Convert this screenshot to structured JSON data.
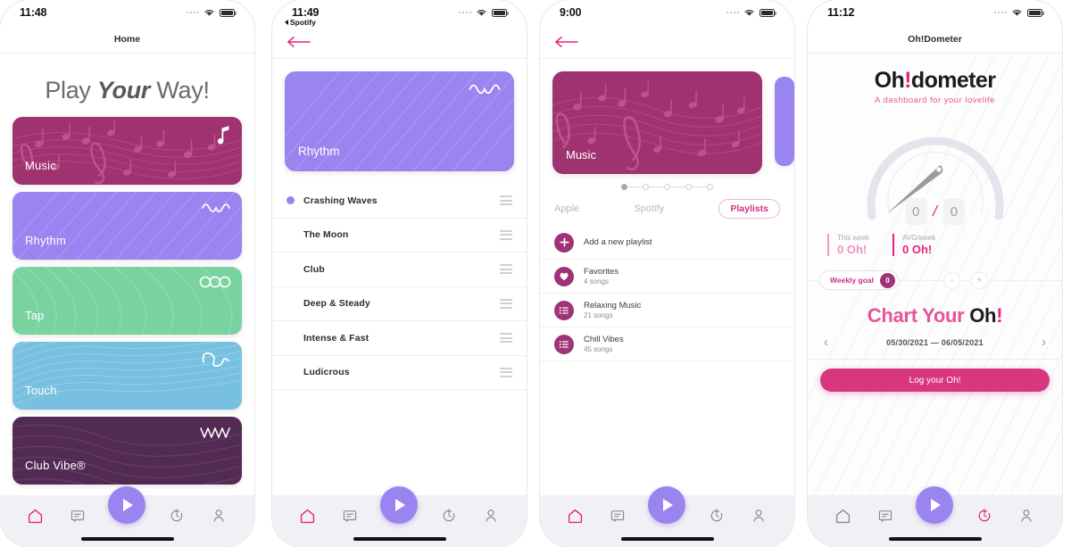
{
  "screens": [
    {
      "status": {
        "time": "11:48"
      },
      "nav": {
        "title": "Home"
      },
      "hero": {
        "pre": "Play ",
        "em": "Your",
        "post": " Way!"
      },
      "cards": [
        {
          "label": "Music",
          "color": "#9e3370",
          "icon": "music-note-icon"
        },
        {
          "label": "Rhythm",
          "color": "#9a84f0",
          "icon": "wave-sine-icon"
        },
        {
          "label": "Tap",
          "color": "#79d3a1",
          "icon": "circles-icon"
        },
        {
          "label": "Touch",
          "color": "#78c0e0",
          "icon": "wave-loop-icon"
        },
        {
          "label": "Club Vibe®",
          "color": "#522b52",
          "icon": "wave-zigzag-icon"
        }
      ],
      "tabbar": {
        "items": [
          "home-icon",
          "message-icon",
          "play-fab",
          "timer-icon",
          "profile-icon"
        ],
        "active": "home-icon"
      }
    },
    {
      "status": {
        "time": "11:49",
        "back_label": "Spotify"
      },
      "nav": {
        "back": "arrow-left-icon"
      },
      "hero_card": {
        "label": "Rhythm",
        "color": "#9a84f0",
        "icon": "wave-sine-icon"
      },
      "tracks": [
        {
          "name": "Crashing Waves",
          "active": true
        },
        {
          "name": "The Moon",
          "active": false
        },
        {
          "name": "Club",
          "active": false
        },
        {
          "name": "Deep & Steady",
          "active": false
        },
        {
          "name": "Intense & Fast",
          "active": false
        },
        {
          "name": "Ludicrous",
          "active": false
        }
      ],
      "tabbar": {
        "items": [
          "home-icon",
          "message-icon",
          "play-fab",
          "timer-icon",
          "profile-icon"
        ],
        "active": "home-icon"
      }
    },
    {
      "status": {
        "time": "9:00"
      },
      "nav": {
        "back": "arrow-left-icon"
      },
      "carousel": {
        "label": "Music",
        "color": "#9e3370",
        "icon": "music-note-icon",
        "peek_color": "#9a84f0",
        "steps": 5,
        "active_step": 1
      },
      "source_tabs": [
        {
          "label": "Apple",
          "selected": false
        },
        {
          "label": "Spotify",
          "selected": false
        },
        {
          "label": "Playlists",
          "selected": true
        }
      ],
      "playlists": [
        {
          "title": "Add a new playlist",
          "subtitle": "",
          "icon": "plus-icon"
        },
        {
          "title": "Favorites",
          "subtitle": "4 songs",
          "icon": "heart-icon"
        },
        {
          "title": "Relaxing Music",
          "subtitle": "21 songs",
          "icon": "list-icon"
        },
        {
          "title": "Chill Vibes",
          "subtitle": "45 songs",
          "icon": "list-icon"
        }
      ],
      "tabbar": {
        "items": [
          "home-icon",
          "message-icon",
          "play-fab",
          "timer-icon",
          "profile-icon"
        ],
        "active": "home-icon"
      }
    },
    {
      "status": {
        "time": "11:12"
      },
      "nav": {
        "title": "Oh!Dometer"
      },
      "logo": {
        "pre": "Oh",
        "em": "!",
        "post": "dometer"
      },
      "tagline": "A dashboard for your lovelife",
      "counter": {
        "left": "0",
        "slash": "/",
        "right": "0"
      },
      "stats": [
        {
          "label": "This week",
          "value": "0 Oh!"
        },
        {
          "label": "AVG/week",
          "value": "0 Oh!"
        }
      ],
      "goal": {
        "label": "Weekly goal",
        "value": "0",
        "minus": "-",
        "plus": "+"
      },
      "chart_title": {
        "pre": "Chart Your ",
        "strong": "Oh",
        "bang": "!"
      },
      "date_range": {
        "prev": "‹",
        "text": "05/30/2021 — 06/05/2021",
        "next": "›"
      },
      "log_button": "Log your Oh!",
      "tabbar": {
        "items": [
          "home-icon",
          "message-icon",
          "play-fab",
          "timer-icon",
          "profile-icon"
        ],
        "active": "timer-icon"
      }
    }
  ],
  "colors": {
    "accent_pink": "#e5227f",
    "accent_purple": "#9a84f0",
    "magenta": "#9e3370",
    "tabbar_bg": "#f1f1f5"
  }
}
